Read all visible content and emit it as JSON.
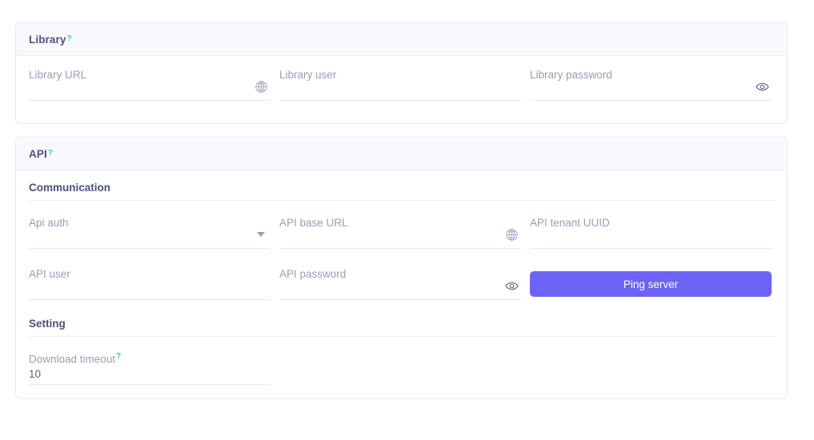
{
  "library_card": {
    "title": "Library",
    "help": "?",
    "fields": [
      {
        "label": "Library URL",
        "value": "",
        "adorn": "globe-icon"
      },
      {
        "label": "Library user",
        "value": "",
        "adorn": "none"
      },
      {
        "label": "Library password",
        "value": "",
        "adorn": "eye-icon"
      }
    ]
  },
  "api_card": {
    "title": "API",
    "help": "?",
    "communication": {
      "heading": "Communication",
      "fields": [
        {
          "label": "Api auth",
          "value": "",
          "adorn": "chevron-down-icon"
        },
        {
          "label": "API base URL",
          "value": "",
          "adorn": "globe-icon"
        },
        {
          "label": "API tenant UUID",
          "value": "",
          "adorn": "none"
        },
        {
          "label": "API user",
          "value": "",
          "adorn": "none"
        },
        {
          "label": "API password",
          "value": "",
          "adorn": "eye-icon"
        }
      ],
      "ping_button": "Ping server"
    },
    "setting": {
      "heading": "Setting",
      "fields": [
        {
          "label": "Download timeout",
          "help": "?",
          "value": "10"
        }
      ]
    }
  },
  "colors": {
    "accent": "#6c63f5",
    "help_mark": "#36cfa2",
    "heading": "#4e5079",
    "label": "#9a9cb8",
    "card_border": "#e8e8f5",
    "header_bg": "#f9f9fd",
    "underline": "#e7e7f3"
  }
}
